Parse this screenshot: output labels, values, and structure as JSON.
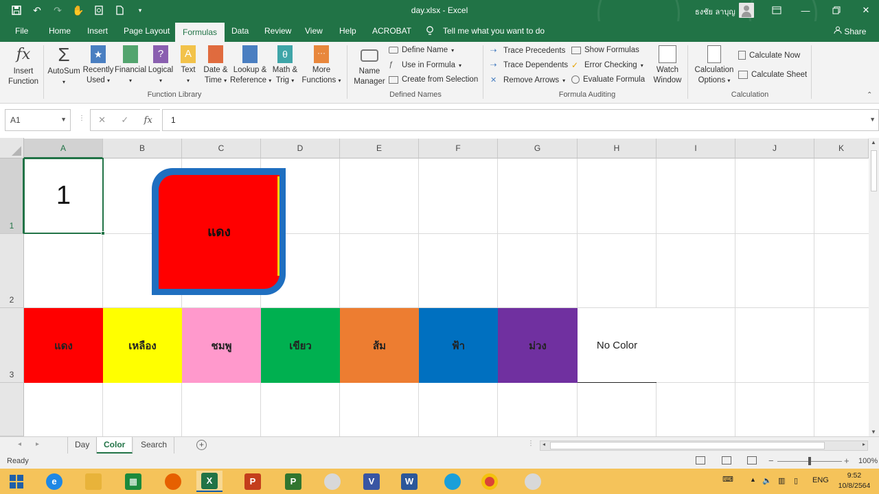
{
  "window": {
    "title": "day.xlsx  -  Excel",
    "user_name": "ธงชัย ลาบุญ",
    "colors": {
      "excel_green": "#217346",
      "taskbar": "#f5c35a"
    }
  },
  "menu": {
    "tabs": [
      "File",
      "Home",
      "Insert",
      "Page Layout",
      "Formulas",
      "Data",
      "Review",
      "View",
      "Help",
      "ACROBAT"
    ],
    "active_tab": "Formulas",
    "tell_me": "Tell me what you want to do",
    "share": "Share"
  },
  "ribbon": {
    "function_library": {
      "insert_function": [
        "Insert",
        "Function"
      ],
      "autosum": "AutoSum",
      "recently_used": [
        "Recently",
        "Used"
      ],
      "financial": "Financial",
      "logical": "Logical",
      "text": "Text",
      "date_time": [
        "Date &",
        "Time"
      ],
      "lookup_reference": [
        "Lookup &",
        "Reference"
      ],
      "math_trig": [
        "Math &",
        "Trig"
      ],
      "more_functions": [
        "More",
        "Functions"
      ],
      "label": "Function Library"
    },
    "defined_names": {
      "name_manager": [
        "Name",
        "Manager"
      ],
      "define_name": "Define Name",
      "use_in_formula": "Use in Formula",
      "create_from_selection": "Create from Selection",
      "label": "Defined Names"
    },
    "formula_auditing": {
      "trace_precedents": "Trace Precedents",
      "trace_dependents": "Trace Dependents",
      "remove_arrows": "Remove Arrows",
      "show_formulas": "Show Formulas",
      "error_checking": "Error Checking",
      "evaluate_formula": "Evaluate Formula",
      "watch_window": [
        "Watch",
        "Window"
      ],
      "label": "Formula Auditing"
    },
    "calculation": {
      "calculation_options": [
        "Calculation",
        "Options"
      ],
      "calculate_now": "Calculate Now",
      "calculate_sheet": "Calculate Sheet",
      "label": "Calculation"
    }
  },
  "formula_bar": {
    "name_box": "A1",
    "formula": "1"
  },
  "sheet": {
    "columns": [
      "A",
      "B",
      "C",
      "D",
      "E",
      "F",
      "G",
      "H",
      "I",
      "J",
      "K"
    ],
    "rows": [
      "1",
      "2",
      "3"
    ],
    "cell_a1": "1",
    "shape_text": "แดง",
    "color_row": [
      {
        "label": "แดง",
        "color": "#ff0000"
      },
      {
        "label": "เหลือง",
        "color": "#ffff00"
      },
      {
        "label": "ชมพู",
        "color": "#ff99cc"
      },
      {
        "label": "เขียว",
        "color": "#00b050"
      },
      {
        "label": "ส้ม",
        "color": "#ed7d31"
      },
      {
        "label": "ฟ้า",
        "color": "#0070c0"
      },
      {
        "label": "ม่วง",
        "color": "#7030a0"
      },
      {
        "label": "No Color",
        "color": "#ffffff"
      }
    ]
  },
  "sheet_tabs": {
    "tabs": [
      "Day",
      "Color",
      "Search"
    ],
    "active": "Color"
  },
  "status_bar": {
    "state": "Ready",
    "zoom": "100%"
  },
  "taskbar": {
    "language": "ENG",
    "time": "9:52",
    "date": "10/8/2564"
  }
}
